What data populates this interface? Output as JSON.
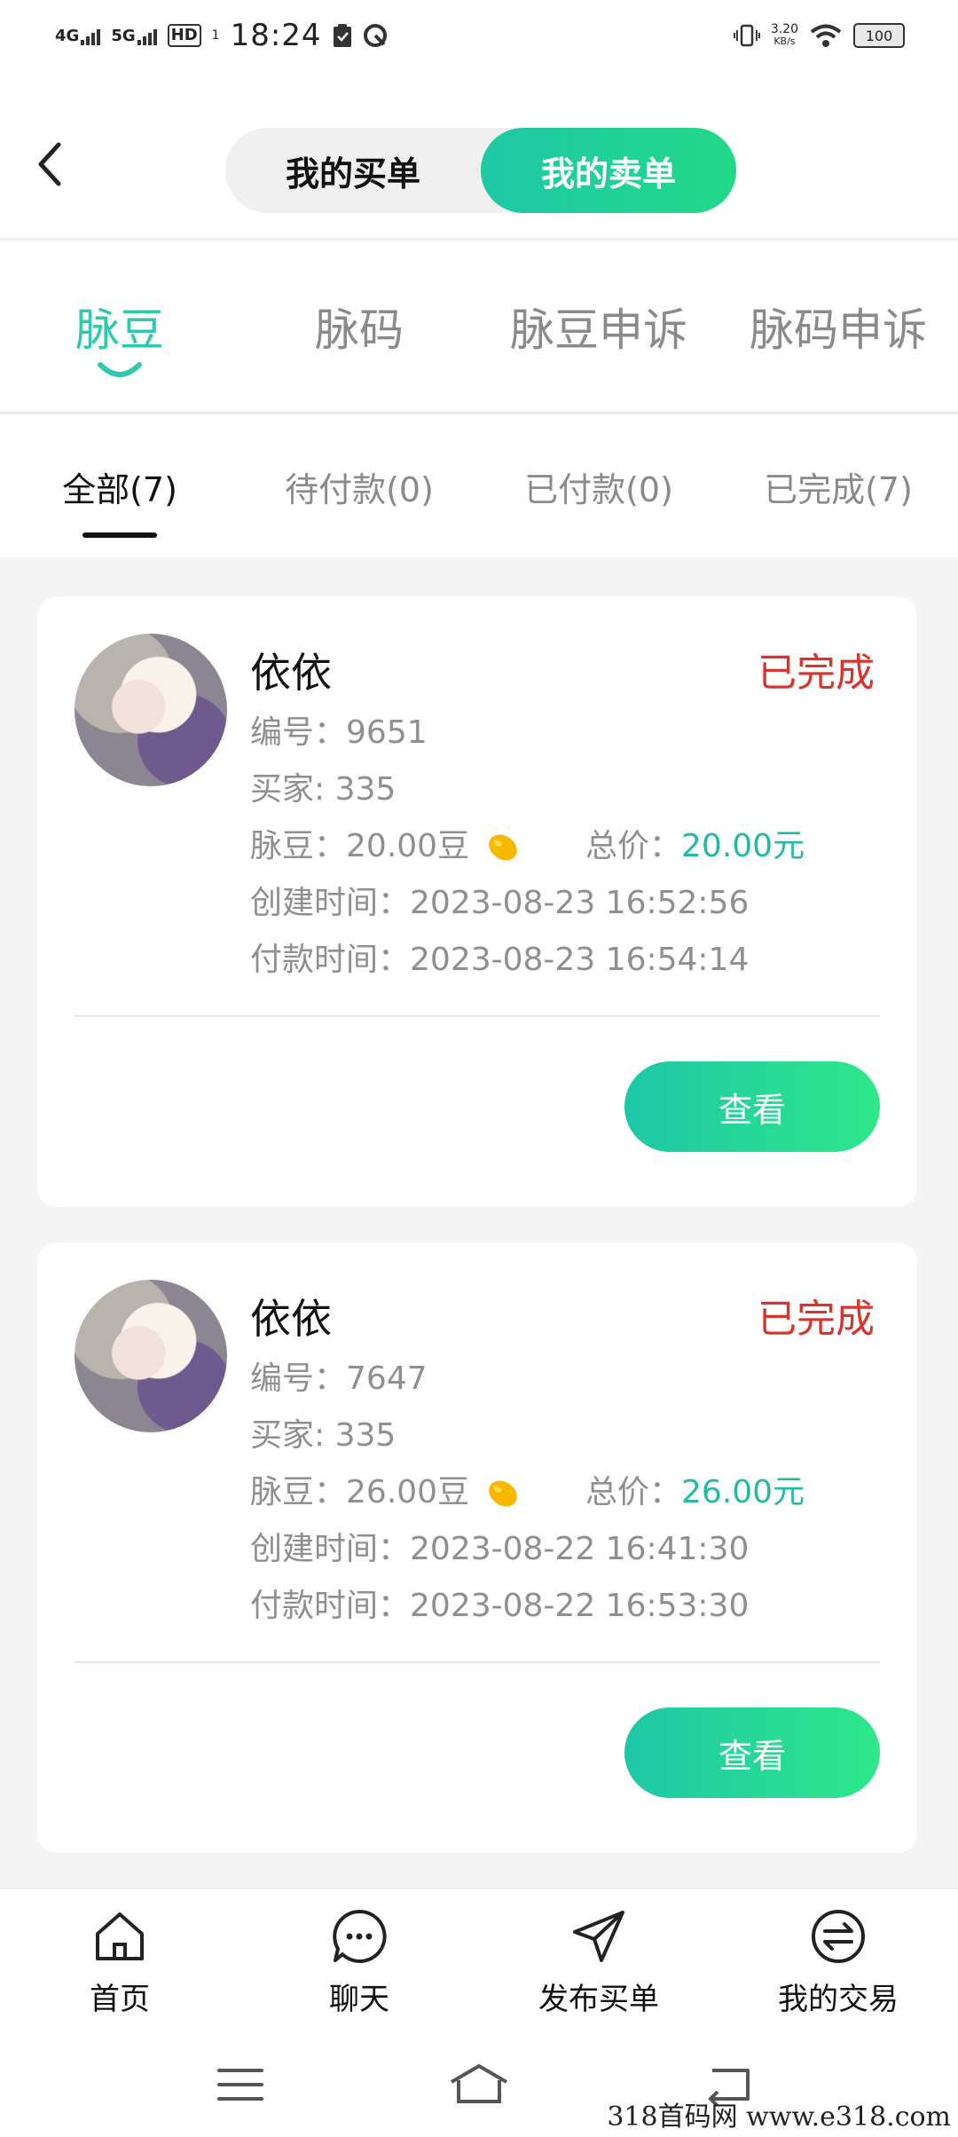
{
  "status_bar": {
    "signal1": "4G",
    "signal2": "5G",
    "hd": "HD",
    "hd_sub": "1",
    "time": "18:24",
    "speed_value": "3.20",
    "speed_unit": "KB/s",
    "battery": "100"
  },
  "header": {
    "segments": [
      "我的买单",
      "我的卖单"
    ],
    "active_segment": 1
  },
  "category_tabs": [
    "脉豆",
    "脉码",
    "脉豆申诉",
    "脉码申诉"
  ],
  "status_tabs": [
    "全部(7)",
    "待付款(0)",
    "已付款(0)",
    "已完成(7)"
  ],
  "orders": [
    {
      "name": "依依",
      "status": "已完成",
      "id_label": "编号：",
      "id": "9651",
      "buyer_label": "买家: ",
      "buyer": "335",
      "bean_label": "脉豆：",
      "bean": "20.00豆",
      "total_label": "总价：",
      "total": "20.00元",
      "created_label": "创建时间：",
      "created": "2023-08-23 16:52:56",
      "paid_label": "付款时间：",
      "paid": "2023-08-23 16:54:14",
      "button": "查看"
    },
    {
      "name": "依依",
      "status": "已完成",
      "id_label": "编号：",
      "id": "7647",
      "buyer_label": "买家: ",
      "buyer": "335",
      "bean_label": "脉豆：",
      "bean": "26.00豆",
      "total_label": "总价：",
      "total": "26.00元",
      "created_label": "创建时间：",
      "created": "2023-08-22 16:41:30",
      "paid_label": "付款时间：",
      "paid": "2023-08-22 16:53:30",
      "button": "查看"
    }
  ],
  "bottom_nav": [
    {
      "label": "首页",
      "icon": "home-icon"
    },
    {
      "label": "聊天",
      "icon": "chat-icon"
    },
    {
      "label": "发布买单",
      "icon": "send-icon"
    },
    {
      "label": "我的交易",
      "icon": "exchange-icon"
    }
  ],
  "watermark": "318首码网  www.e318.com",
  "colors": {
    "accent": "#2ec9ad",
    "status_done": "#d9342b",
    "button_gradient_start": "#1ec7a7",
    "button_gradient_end": "#2ee88a"
  }
}
